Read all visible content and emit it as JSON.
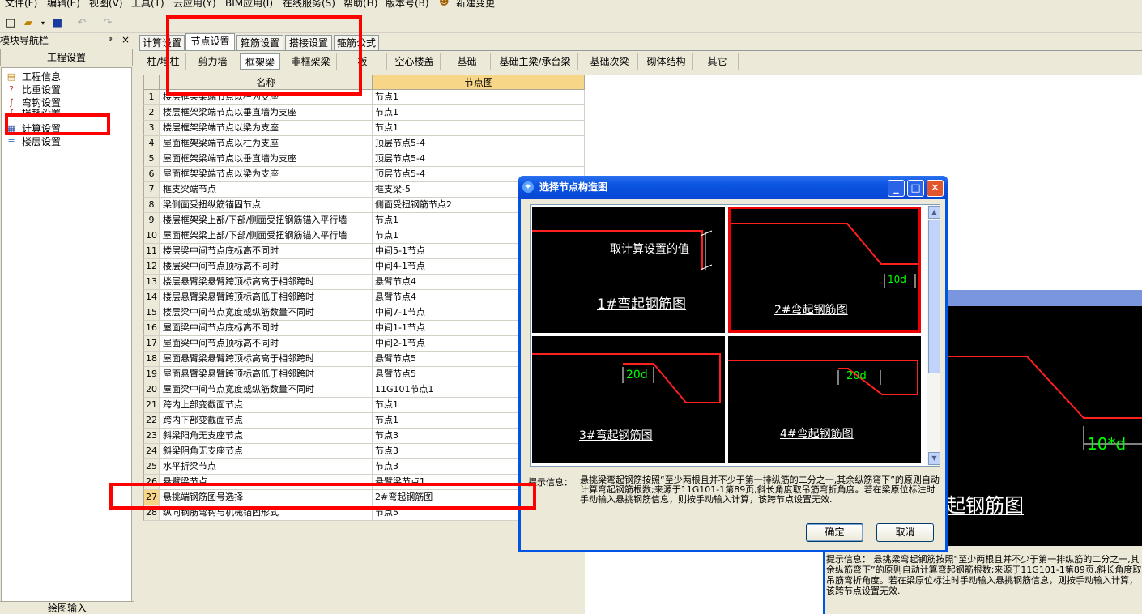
{
  "menu": [
    "文件(F)",
    "编辑(E)",
    "视图(V)",
    "工具(T)",
    "云应用(Y)",
    "BIM应用(I)",
    "在线服务(S)",
    "帮助(H)",
    "版本号(B)",
    "新建变更"
  ],
  "nav": {
    "title": "模块导航栏",
    "header": "工程设置",
    "items": [
      "工程信息",
      "比重设置",
      "弯钩设置",
      "损耗设置",
      "计算设置",
      "楼层设置"
    ],
    "bottom": "绘图输入"
  },
  "tabs_top": [
    "计算设置",
    "节点设置",
    "箍筋设置",
    "搭接设置",
    "箍筋公式"
  ],
  "tabs_sub": [
    "柱/墙柱",
    "剪力墙",
    "框架梁",
    "非框架梁",
    "板",
    "空心楼盖",
    "基础",
    "基础主梁/承台梁",
    "基础次梁",
    "砌体结构",
    "其它"
  ],
  "grid": {
    "col_name": "名称",
    "col_value": "节点图",
    "rows": [
      {
        "n": "1",
        "name": "楼层框架梁端节点以柱为支座",
        "value": "节点1"
      },
      {
        "n": "2",
        "name": "楼层框架梁端节点以垂直墙为支座",
        "value": "节点1"
      },
      {
        "n": "3",
        "name": "楼层框架梁端节点以梁为支座",
        "value": "节点1"
      },
      {
        "n": "4",
        "name": "屋面框架梁端节点以柱为支座",
        "value": "顶层节点5-4"
      },
      {
        "n": "5",
        "name": "屋面框架梁端节点以垂直墙为支座",
        "value": "顶层节点5-4"
      },
      {
        "n": "6",
        "name": "屋面框架梁端节点以梁为支座",
        "value": "顶层节点5-4"
      },
      {
        "n": "7",
        "name": "框支梁端节点",
        "value": "框支梁-5"
      },
      {
        "n": "8",
        "name": "梁侧面受扭纵筋锚固节点",
        "value": "侧面受扭钢筋节点2"
      },
      {
        "n": "9",
        "name": "楼层框架梁上部/下部/侧面受扭钢筋锚入平行墙",
        "value": "节点1"
      },
      {
        "n": "10",
        "name": "屋面框架梁上部/下部/侧面受扭钢筋锚入平行墙",
        "value": "节点1"
      },
      {
        "n": "11",
        "name": "楼层梁中间节点底标高不同时",
        "value": "中间5-1节点"
      },
      {
        "n": "12",
        "name": "楼层梁中间节点顶标高不同时",
        "value": "中间4-1节点"
      },
      {
        "n": "13",
        "name": "楼层悬臂梁悬臂跨顶标高高于相邻跨时",
        "value": "悬臂节点4"
      },
      {
        "n": "14",
        "name": "楼层悬臂梁悬臂跨顶标高低于相邻跨时",
        "value": "悬臂节点4"
      },
      {
        "n": "15",
        "name": "楼层梁中间节点宽度或纵筋数量不同时",
        "value": "中间7-1节点"
      },
      {
        "n": "16",
        "name": "屋面梁中间节点底标高不同时",
        "value": "中间1-1节点"
      },
      {
        "n": "17",
        "name": "屋面梁中间节点顶标高不同时",
        "value": "中间2-1节点"
      },
      {
        "n": "18",
        "name": "屋面悬臂梁悬臂跨顶标高高于相邻跨时",
        "value": "悬臂节点5"
      },
      {
        "n": "19",
        "name": "屋面悬臂梁悬臂跨顶标高低于相邻跨时",
        "value": "悬臂节点5"
      },
      {
        "n": "20",
        "name": "屋面梁中间节点宽度或纵筋数量不同时",
        "value": "11G101节点1"
      },
      {
        "n": "21",
        "name": "跨内上部变截面节点",
        "value": "节点1"
      },
      {
        "n": "22",
        "name": "跨内下部变截面节点",
        "value": "节点1"
      },
      {
        "n": "23",
        "name": "斜梁阳角无支座节点",
        "value": "节点3"
      },
      {
        "n": "24",
        "name": "斜梁阴角无支座节点",
        "value": "节点3"
      },
      {
        "n": "25",
        "name": "水平折梁节点",
        "value": "节点3"
      },
      {
        "n": "26",
        "name": "悬臂梁节点",
        "value": "悬臂梁节点1"
      },
      {
        "n": "27",
        "name": "悬挑端钢筋图号选择",
        "value": "2#弯起钢筋图"
      },
      {
        "n": "28",
        "name": "纵向钢筋弯钩与机械锚固形式",
        "value": "节点5"
      }
    ]
  },
  "dialog": {
    "title": "选择节点构造图",
    "cells": [
      {
        "label": "1#弯起钢筋图",
        "note": "取计算设置的值"
      },
      {
        "label": "2#弯起钢筋图",
        "dim": "10d"
      },
      {
        "label": "3#弯起钢筋图",
        "dim": "20d"
      },
      {
        "label": "4#弯起钢筋图",
        "dim": "20d"
      }
    ],
    "hint_label": "提示信息：",
    "hint": "悬挑梁弯起钢筋按照“至少两根且并不少于第一排纵筋的二分之一,其余纵筋弯下”的原则自动计算弯起钢筋根数;来源于11G101-1第89页,斜长角度取吊筋弯折角度。若在梁原位标注时手动输入悬挑钢筋信息，则按手动输入计算，该跨节点设置无效.",
    "ok": "确定",
    "cancel": "取消"
  },
  "bg_window": {
    "dim": "10*d",
    "label": "起钢筋图",
    "hint_label": "提示信息：",
    "hint": "悬挑梁弯起钢筋按照“至少两根且并不少于第一排纵筋的二分之一,其余纵筋弯下”的原则自动计算弯起钢筋根数;来源于11G101-1第89页,斜长角度取吊筋弯折角度。若在梁原位标注时手动输入悬挑钢筋信息，则按手动输入计算，该跨节点设置无效."
  },
  "colors": {
    "selected_header": "#f8d688",
    "highlight": "#ff0000",
    "title_bar": "#0a53e0",
    "dim_text": "#00ff00"
  }
}
